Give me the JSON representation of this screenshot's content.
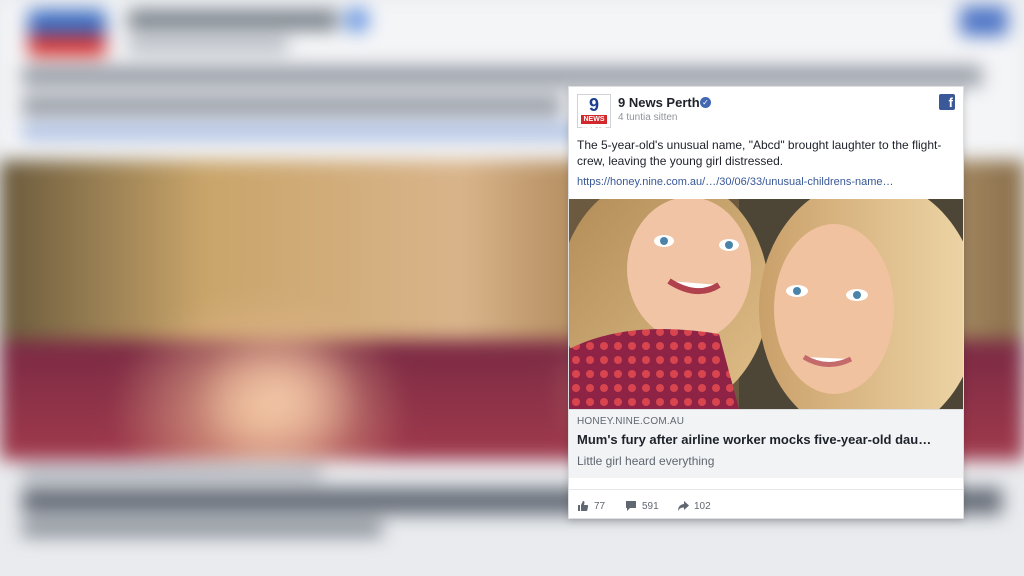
{
  "post": {
    "page_name": "9 News Perth",
    "logo_number": "9",
    "logo_label": "NEWS PERTH",
    "time_ago": "4 tuntia sitten",
    "text": "The 5-year-old's unusual name, \"Abcd\" brought laughter to the flight-crew, leaving the young girl distressed.",
    "url": "https://honey.nine.com.au/…/30/06/33/unusual-childrens-name…"
  },
  "link_preview": {
    "domain": "HONEY.NINE.COM.AU",
    "title": "Mum's fury after airline worker mocks five-year-old dau…",
    "description": "Little girl heard everything"
  },
  "reactions": {
    "likes": "77",
    "comments": "591",
    "shares": "102"
  },
  "colors": {
    "facebook_blue": "#3b5998",
    "link_blue": "#385898",
    "nine_red": "#d3282b"
  },
  "icons": [
    "verified-badge-icon",
    "facebook-icon",
    "thumbs-up-icon",
    "comment-icon",
    "share-icon"
  ]
}
